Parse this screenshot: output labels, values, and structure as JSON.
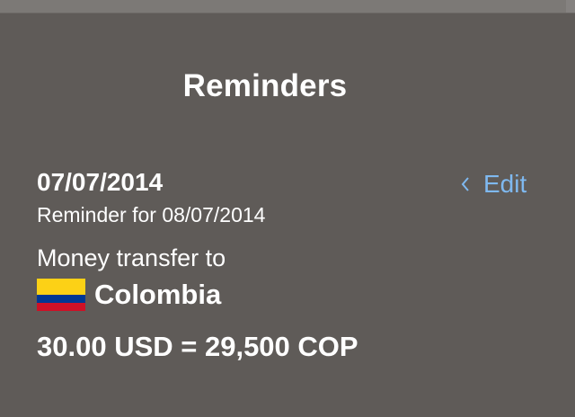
{
  "header": {
    "title": "Reminders"
  },
  "reminder": {
    "date": "07/07/2014",
    "reminder_for": "Reminder for 08/07/2014",
    "edit_label": "Edit",
    "transfer_label": "Money transfer to",
    "country": "Colombia",
    "amount": "30.00 USD = 29,500 COP"
  },
  "icons": {
    "flag": "colombia-flag-icon",
    "edit_chevron": "chevron-left-icon"
  },
  "colors": {
    "background": "#5f5b58",
    "accent": "#7fb9f0",
    "flag_yellow": "#fcd116",
    "flag_blue": "#003893",
    "flag_red": "#ce1126"
  }
}
